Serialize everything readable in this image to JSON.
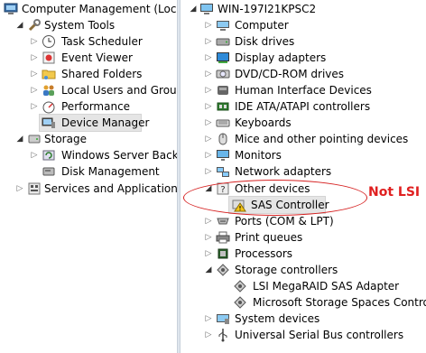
{
  "left_tree": {
    "root": "Computer Management (Local",
    "system_tools": "System Tools",
    "task_scheduler": "Task Scheduler",
    "event_viewer": "Event Viewer",
    "shared_folders": "Shared Folders",
    "local_users": "Local Users and Groups",
    "performance": "Performance",
    "device_manager": "Device Manager",
    "storage": "Storage",
    "wsb": "Windows Server Backup",
    "disk_mgmt": "Disk Management",
    "services_apps": "Services and Applications"
  },
  "right_tree": {
    "root": "WIN-197I21KPSC2",
    "computer": "Computer",
    "disk_drives": "Disk drives",
    "display_adapters": "Display adapters",
    "dvd": "DVD/CD-ROM drives",
    "hid": "Human Interface Devices",
    "ide": "IDE ATA/ATAPI controllers",
    "keyboards": "Keyboards",
    "mice": "Mice and other pointing devices",
    "monitors": "Monitors",
    "network": "Network adapters",
    "other": "Other devices",
    "sas": "SAS Controller",
    "ports": "Ports (COM & LPT)",
    "print_queues": "Print queues",
    "processors": "Processors",
    "storage_ctrl": "Storage controllers",
    "lsi": "LSI MegaRAID SAS Adapter",
    "ms_storage": "Microsoft Storage Spaces Controller",
    "system_devices": "System devices",
    "usb": "Universal Serial Bus controllers"
  },
  "annotation": {
    "text": "Not LSI",
    "color": "#e02020"
  },
  "colors": {
    "selection": "#e5e5e5",
    "expander": "#6d6d6d"
  }
}
